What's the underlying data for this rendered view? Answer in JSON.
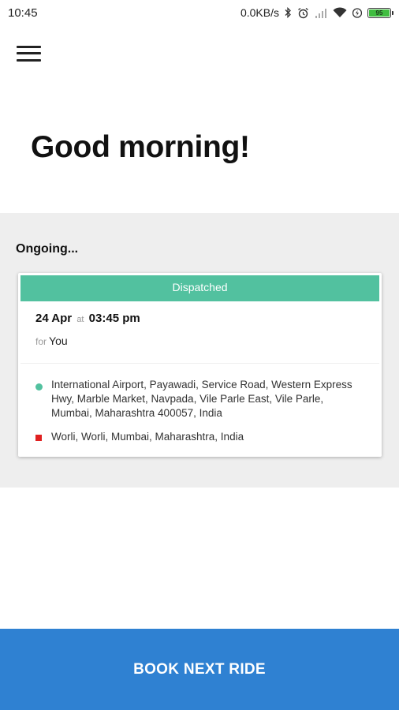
{
  "status_bar": {
    "time": "10:45",
    "network_speed": "0.0KB/s",
    "battery_level": "95",
    "icons": [
      "bluetooth-icon",
      "alarm-icon",
      "signal-icon",
      "wifi-icon",
      "charging-icon",
      "battery-icon"
    ]
  },
  "header": {
    "menu_icon": "hamburger-menu-icon"
  },
  "greeting": "Good morning!",
  "ongoing": {
    "label": "Ongoing...",
    "ride": {
      "status": "Dispatched",
      "status_color": "#52c19f",
      "date": "24 Apr",
      "at_word": "at",
      "time": "03:45 pm",
      "for_word": "for",
      "passenger": "You",
      "pickup": "International Airport, Payawadi, Service Road, Western Express Hwy, Marble Market, Navpada, Vile Parle East, Vile Parle, Mumbai, Maharashtra 400057, India",
      "pickup_marker_color": "#52c19f",
      "drop": "Worli, Worli, Mumbai, Maharashtra, India",
      "drop_marker_color": "#e02020"
    }
  },
  "book_button": {
    "label": "BOOK NEXT RIDE",
    "color": "#2f81d2"
  }
}
